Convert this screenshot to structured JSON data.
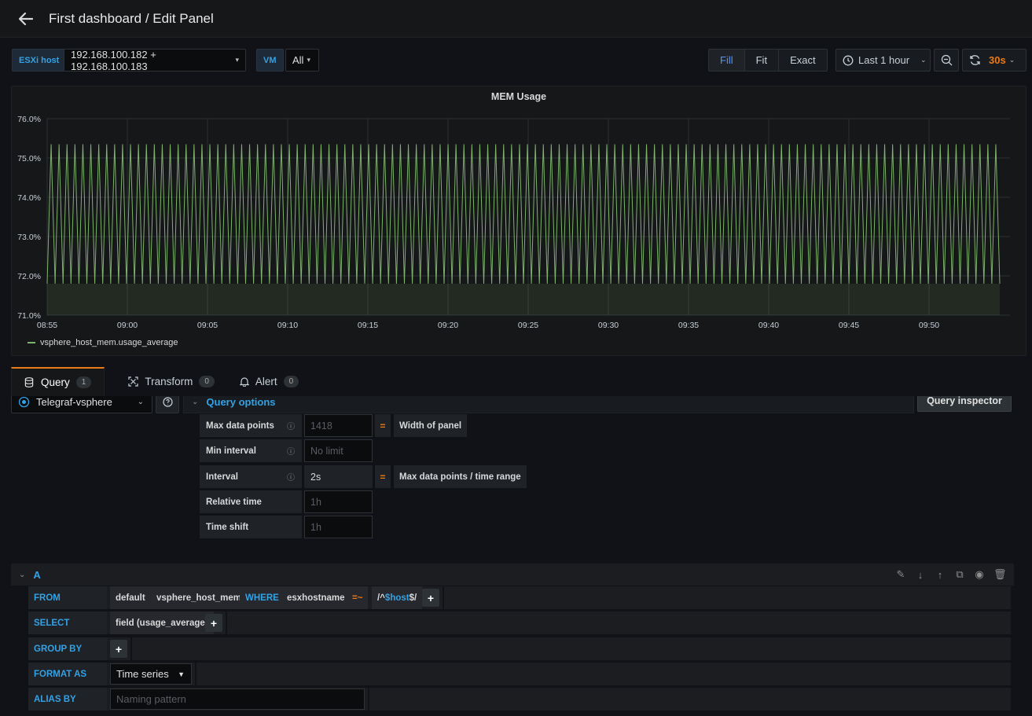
{
  "header": {
    "title": "First dashboard / Edit Panel"
  },
  "variables": {
    "esxi_label": "ESXi host",
    "esxi_value": "192.168.100.182 + 192.168.100.183",
    "vm_label": "VM",
    "vm_value": "All"
  },
  "toolbar": {
    "fill": "Fill",
    "fit": "Fit",
    "exact": "Exact",
    "time_range": "Last 1 hour",
    "refresh_interval": "30s"
  },
  "panel": {
    "title": "MEM Usage"
  },
  "chart_data": {
    "type": "line",
    "title": "MEM Usage",
    "ylim": [
      71.0,
      76.0
    ],
    "yticks": [
      "71.0%",
      "72.0%",
      "73.0%",
      "74.0%",
      "75.0%",
      "76.0%"
    ],
    "xticks": [
      "08:55",
      "09:00",
      "09:05",
      "09:10",
      "09:15",
      "09:20",
      "09:25",
      "09:30",
      "09:35",
      "09:40",
      "09:45",
      "09:50"
    ],
    "series": [
      {
        "name": "vsphere_host_mem.usage_average",
        "color": "#7eb26d",
        "low": 71.8,
        "high": 75.35,
        "oscillations": 120
      }
    ]
  },
  "tabs": [
    {
      "label": "Query",
      "count": "1"
    },
    {
      "label": "Transform",
      "count": "0"
    },
    {
      "label": "Alert",
      "count": "0"
    }
  ],
  "datasource": {
    "name": "Telegraf-vsphere"
  },
  "query_options": {
    "title": "Query options",
    "inspector": "Query inspector",
    "rows": {
      "max_data_points": {
        "label": "Max data points",
        "placeholder": "1418",
        "eq": "=",
        "note": "Width of panel"
      },
      "min_interval": {
        "label": "Min interval",
        "placeholder": "No limit"
      },
      "interval": {
        "label": "Interval",
        "value": "2s",
        "eq": "=",
        "note": "Max data points / time range"
      },
      "relative_time": {
        "label": "Relative time",
        "placeholder": "1h"
      },
      "time_shift": {
        "label": "Time shift",
        "placeholder": "1h"
      }
    }
  },
  "query": {
    "name": "A",
    "from_kw": "FROM",
    "policy": "default",
    "measurement": "vsphere_host_mem",
    "where_kw": "WHERE",
    "where_key": "esxhostname",
    "where_op": "=~",
    "where_val_prefix": "/^",
    "where_val_var": "$host",
    "where_val_suffix": "$/",
    "select_kw": "SELECT",
    "select_field": "field (usage_average)",
    "groupby_kw": "GROUP BY",
    "format_kw": "FORMAT AS",
    "format_value": "Time series",
    "alias_kw": "ALIAS BY",
    "alias_placeholder": "Naming pattern",
    "plus": "+"
  }
}
